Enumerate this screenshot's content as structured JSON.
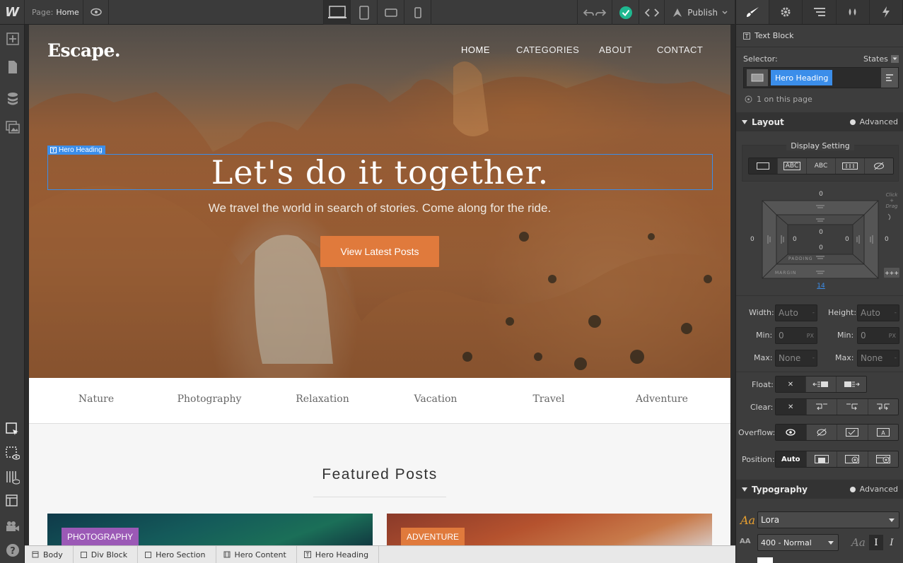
{
  "topbar": {
    "logo": "W",
    "page_label": "Page:",
    "page_name": "Home",
    "publish_label": "Publish"
  },
  "canvas": {
    "brand": "Escape.",
    "nav": [
      "HOME",
      "CATEGORIES",
      "ABOUT",
      "CONTACT"
    ],
    "hero_tag": "Hero Heading",
    "hero_heading": "Let's do it together.",
    "hero_sub": "We travel the world in search of stories. Come along for the ride.",
    "cta": "View Latest Posts",
    "categories": [
      "Nature",
      "Photography",
      "Relaxation",
      "Vacation",
      "Travel",
      "Adventure"
    ],
    "featured": "Featured Posts",
    "cards": [
      {
        "badge": "PHOTOGRAPHY",
        "badge_color": "#9b59b6"
      },
      {
        "badge": "ADVENTURE",
        "badge_color": "#e07a3c"
      }
    ]
  },
  "breadcrumb": [
    "Body",
    "Div Block",
    "Hero Section",
    "Hero Content",
    "Hero Heading"
  ],
  "panel": {
    "element_type": "Text Block",
    "selector_label": "Selector:",
    "states_label": "States",
    "selector_value": "Hero Heading",
    "on_page": "1 on this page",
    "layout_header": "Layout",
    "advanced": "Advanced",
    "display_setting": "Display Setting",
    "display_opts": [
      "",
      "ABC",
      "ABC",
      "",
      ""
    ],
    "box": {
      "margin_top": "0",
      "margin_left": "0",
      "margin_right": "0",
      "margin_bottom": "14",
      "padding_top": "0",
      "padding_left": "0",
      "padding_right": "0",
      "padding_bottom": "0",
      "padding_label": "PADDING",
      "margin_label": "MARGIN",
      "hint": "Click + Drag"
    },
    "width_label": "Width:",
    "width_val": "Auto",
    "height_label": "Height:",
    "height_val": "Auto",
    "min_label": "Min:",
    "min_w": "0",
    "min_h": "0",
    "px": "PX",
    "max_label": "Max:",
    "max_w": "None",
    "max_h": "None",
    "float_label": "Float:",
    "clear_label": "Clear:",
    "overflow_label": "Overflow:",
    "position_label": "Position:",
    "position_val": "Auto",
    "typography_header": "Typography",
    "font": "Lora",
    "weight": "400 - Normal",
    "aa": "Aa"
  }
}
